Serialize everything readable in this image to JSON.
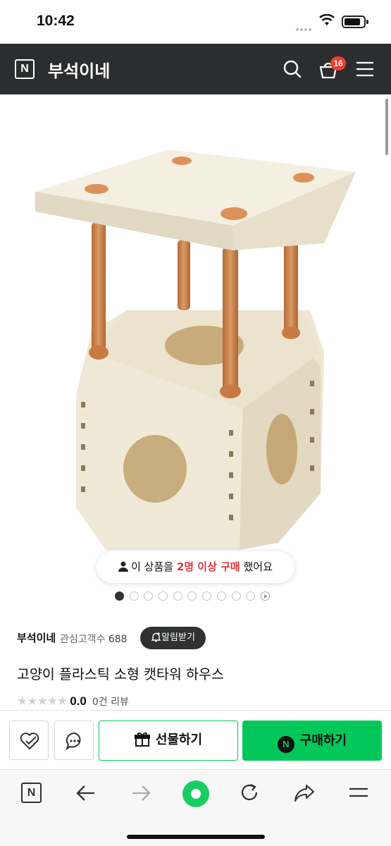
{
  "status_bar": {
    "time": "10:42"
  },
  "header": {
    "store_name": "부석이네",
    "logo_letter": "N",
    "cart_count": "16"
  },
  "product_image": {
    "buyer_notice": {
      "prefix": "이 상품을",
      "highlight": "2명 이상 구매",
      "suffix": "했어요"
    },
    "page_count": 11,
    "active_page": 1
  },
  "seller": {
    "name": "부석이네",
    "fans_label": "관심고객수",
    "fans_count": "688",
    "alarm_label": "알림받기"
  },
  "product": {
    "title": "고양이 플라스틱 소형 캣타워 하우스",
    "stars": "★★★★★",
    "score": "0.0",
    "reviews": "0건 리뷰"
  },
  "buy_bar": {
    "gift_label": "선물하기",
    "buy_label": "구매하기",
    "buy_logo": "N"
  },
  "toolbar": {
    "logo_letter": "N"
  },
  "colors": {
    "header_bg": "#2b2d2e",
    "naver_green": "#03c75a",
    "badge_red": "#f23c2f",
    "highlight_red": "#e1373f"
  }
}
